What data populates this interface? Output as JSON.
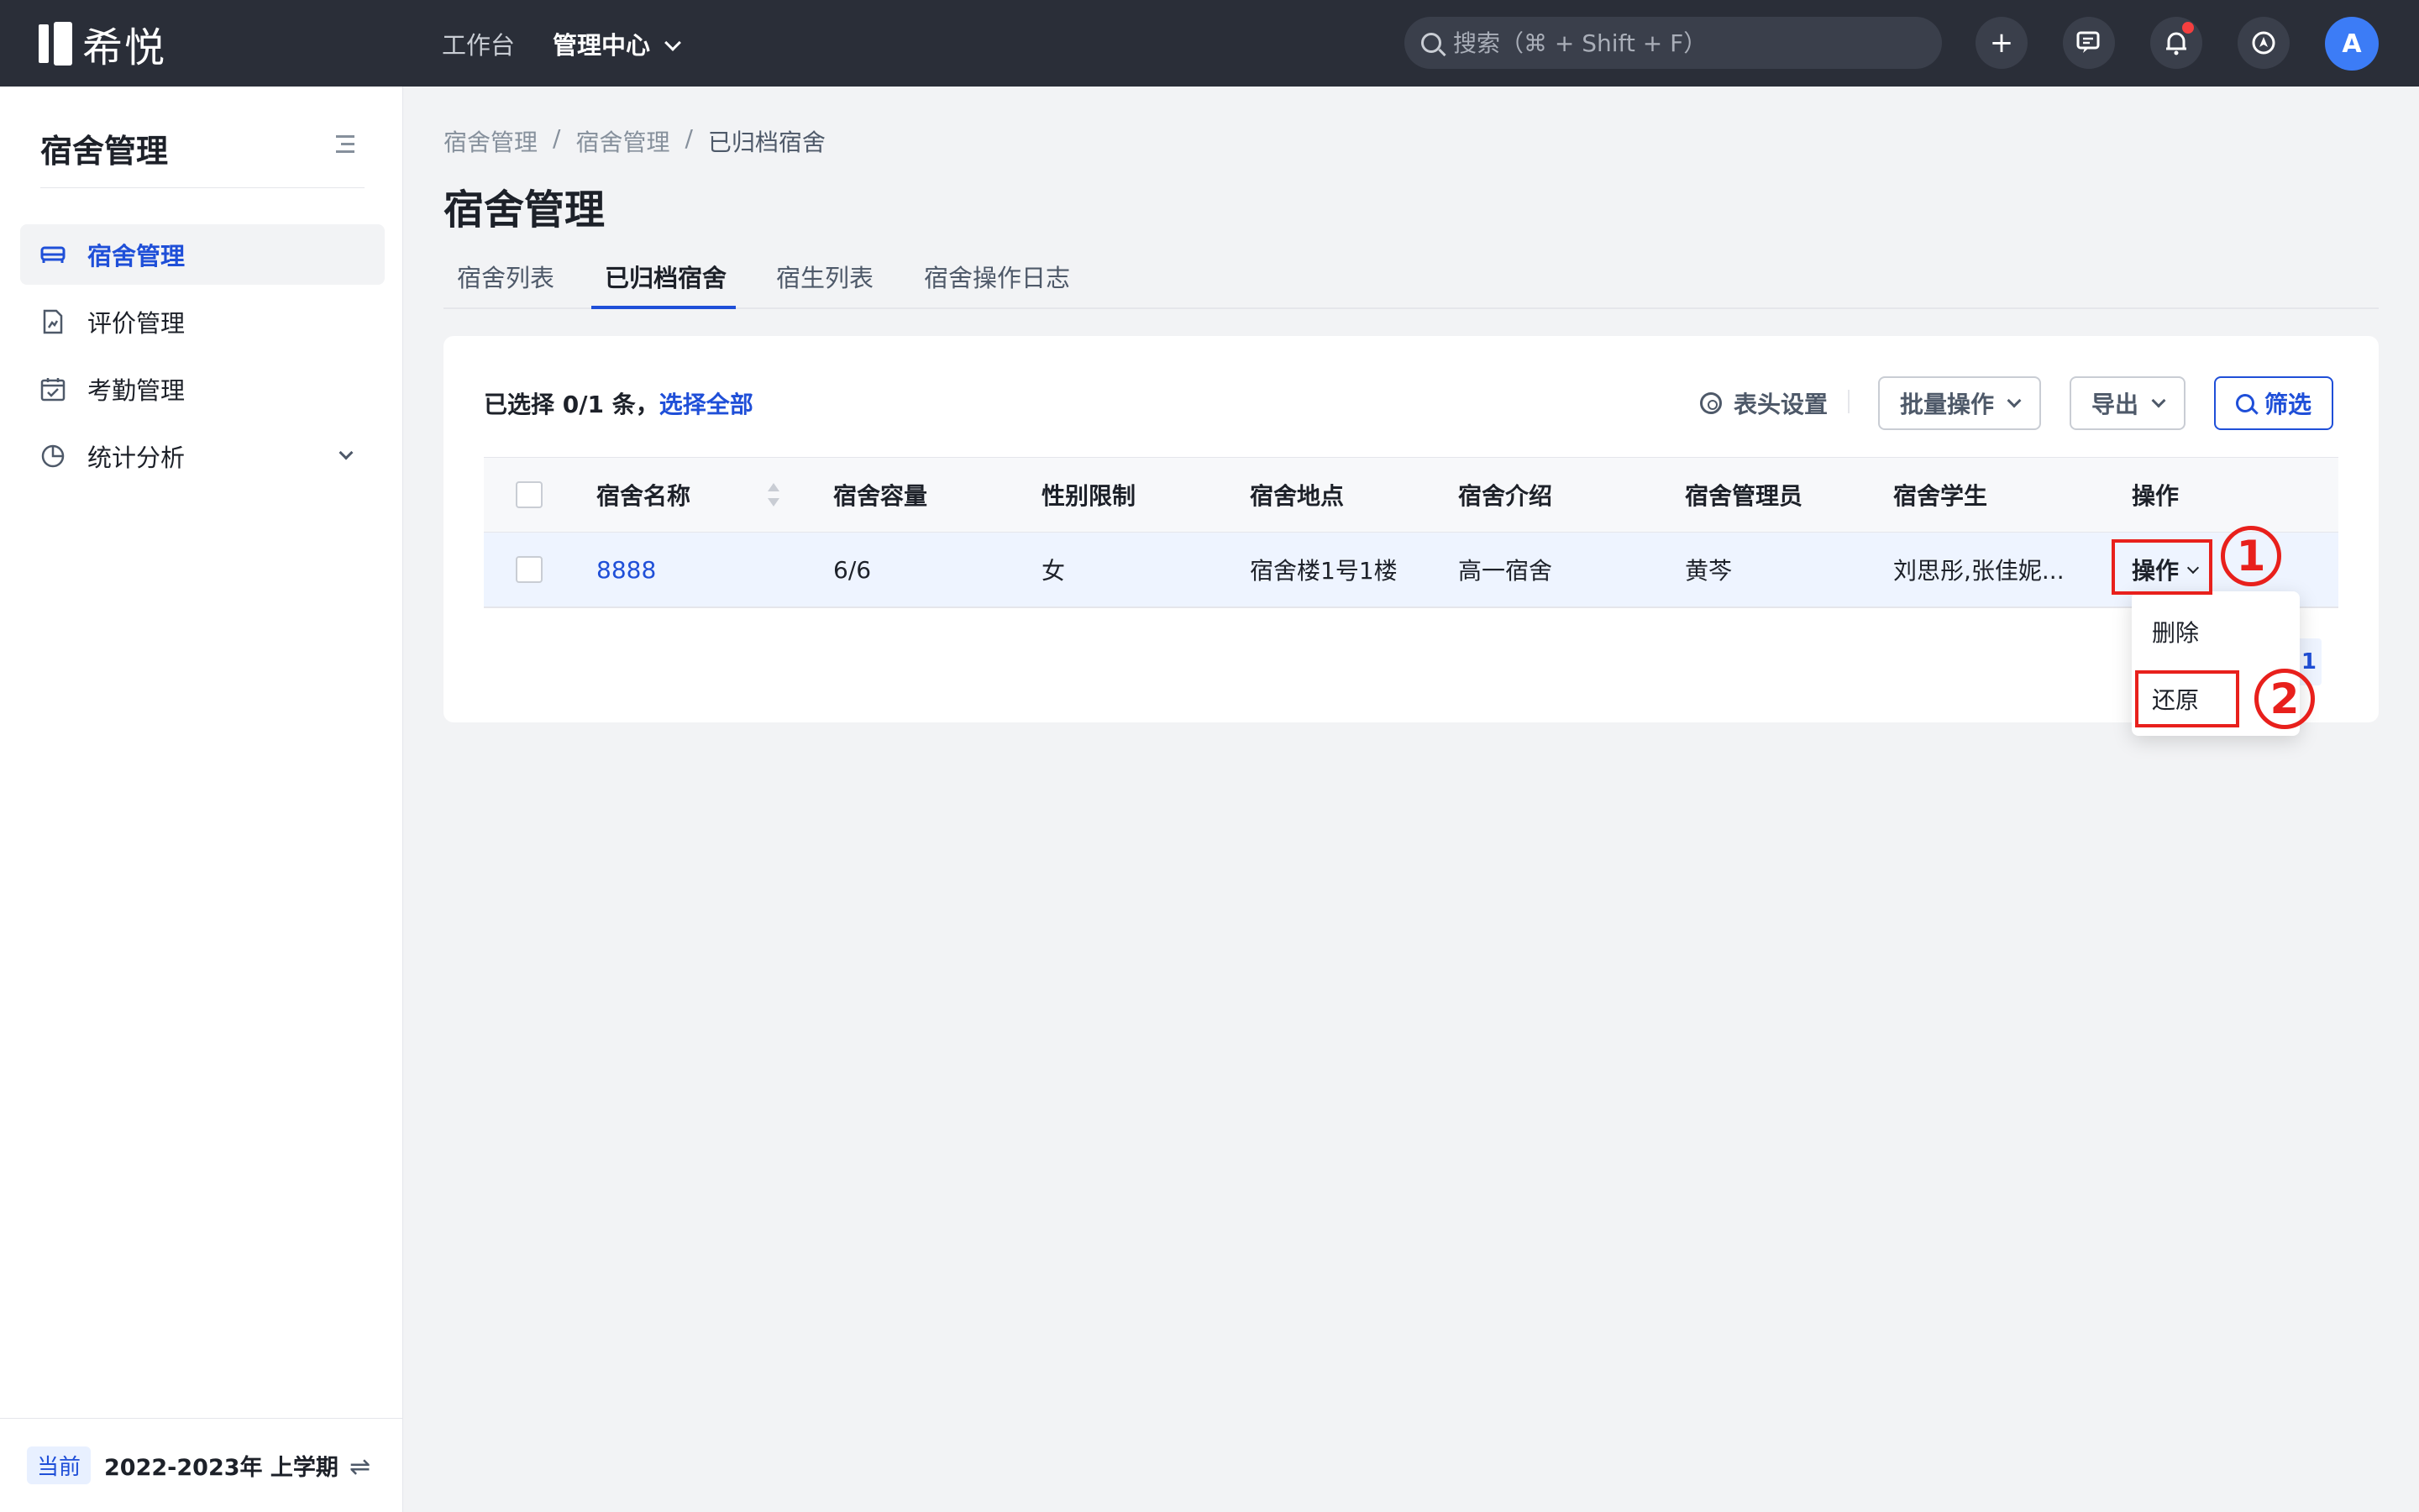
{
  "app": {
    "name": "希悦"
  },
  "topnav": {
    "workbench": "工作台",
    "admin_center": "管理中心"
  },
  "search": {
    "placeholder": "搜索（⌘ + Shift + F）"
  },
  "user": {
    "avatar_initial": "A"
  },
  "sidebar": {
    "title": "宿舍管理",
    "items": [
      {
        "label": "宿舍管理",
        "icon": "bed-icon",
        "active": true
      },
      {
        "label": "评价管理",
        "icon": "evaluation-doc-icon",
        "active": false
      },
      {
        "label": "考勤管理",
        "icon": "calendar-check-icon",
        "active": false
      },
      {
        "label": "统计分析",
        "icon": "pie-chart-icon",
        "active": false,
        "expandable": true
      }
    ],
    "term_tag": "当前",
    "term_text": "2022-2023年 上学期"
  },
  "breadcrumb": [
    "宿舍管理",
    "宿舍管理",
    "已归档宿舍"
  ],
  "page_title": "宿舍管理",
  "tabs": [
    "宿舍列表",
    "已归档宿舍",
    "宿生列表",
    "宿舍操作日志"
  ],
  "active_tab": "已归档宿舍",
  "toolbar": {
    "selection_text": "已选择 0/1 条，",
    "select_all": "选择全部",
    "header_settings": "表头设置",
    "batch": "批量操作",
    "export": "导出",
    "filter": "筛选"
  },
  "table": {
    "columns": [
      "宿舍名称",
      "宿舍容量",
      "性别限制",
      "宿舍地点",
      "宿舍介绍",
      "宿舍管理员",
      "宿舍学生",
      "操作"
    ],
    "rows": [
      [
        "8888",
        "6/6",
        "女",
        "宿舍楼1号1楼",
        "高一宿舍",
        "黄芩",
        "刘思彤,张佳妮...",
        "操作"
      ]
    ]
  },
  "pagination": {
    "current": "1"
  },
  "dropdown": {
    "items": [
      "删除",
      "还原"
    ]
  },
  "annotations": {
    "step1": "1",
    "step2": "2"
  },
  "colors": {
    "accent": "#1f4fd8",
    "topbar": "#2a2e38",
    "highlight": "#e8201c"
  }
}
